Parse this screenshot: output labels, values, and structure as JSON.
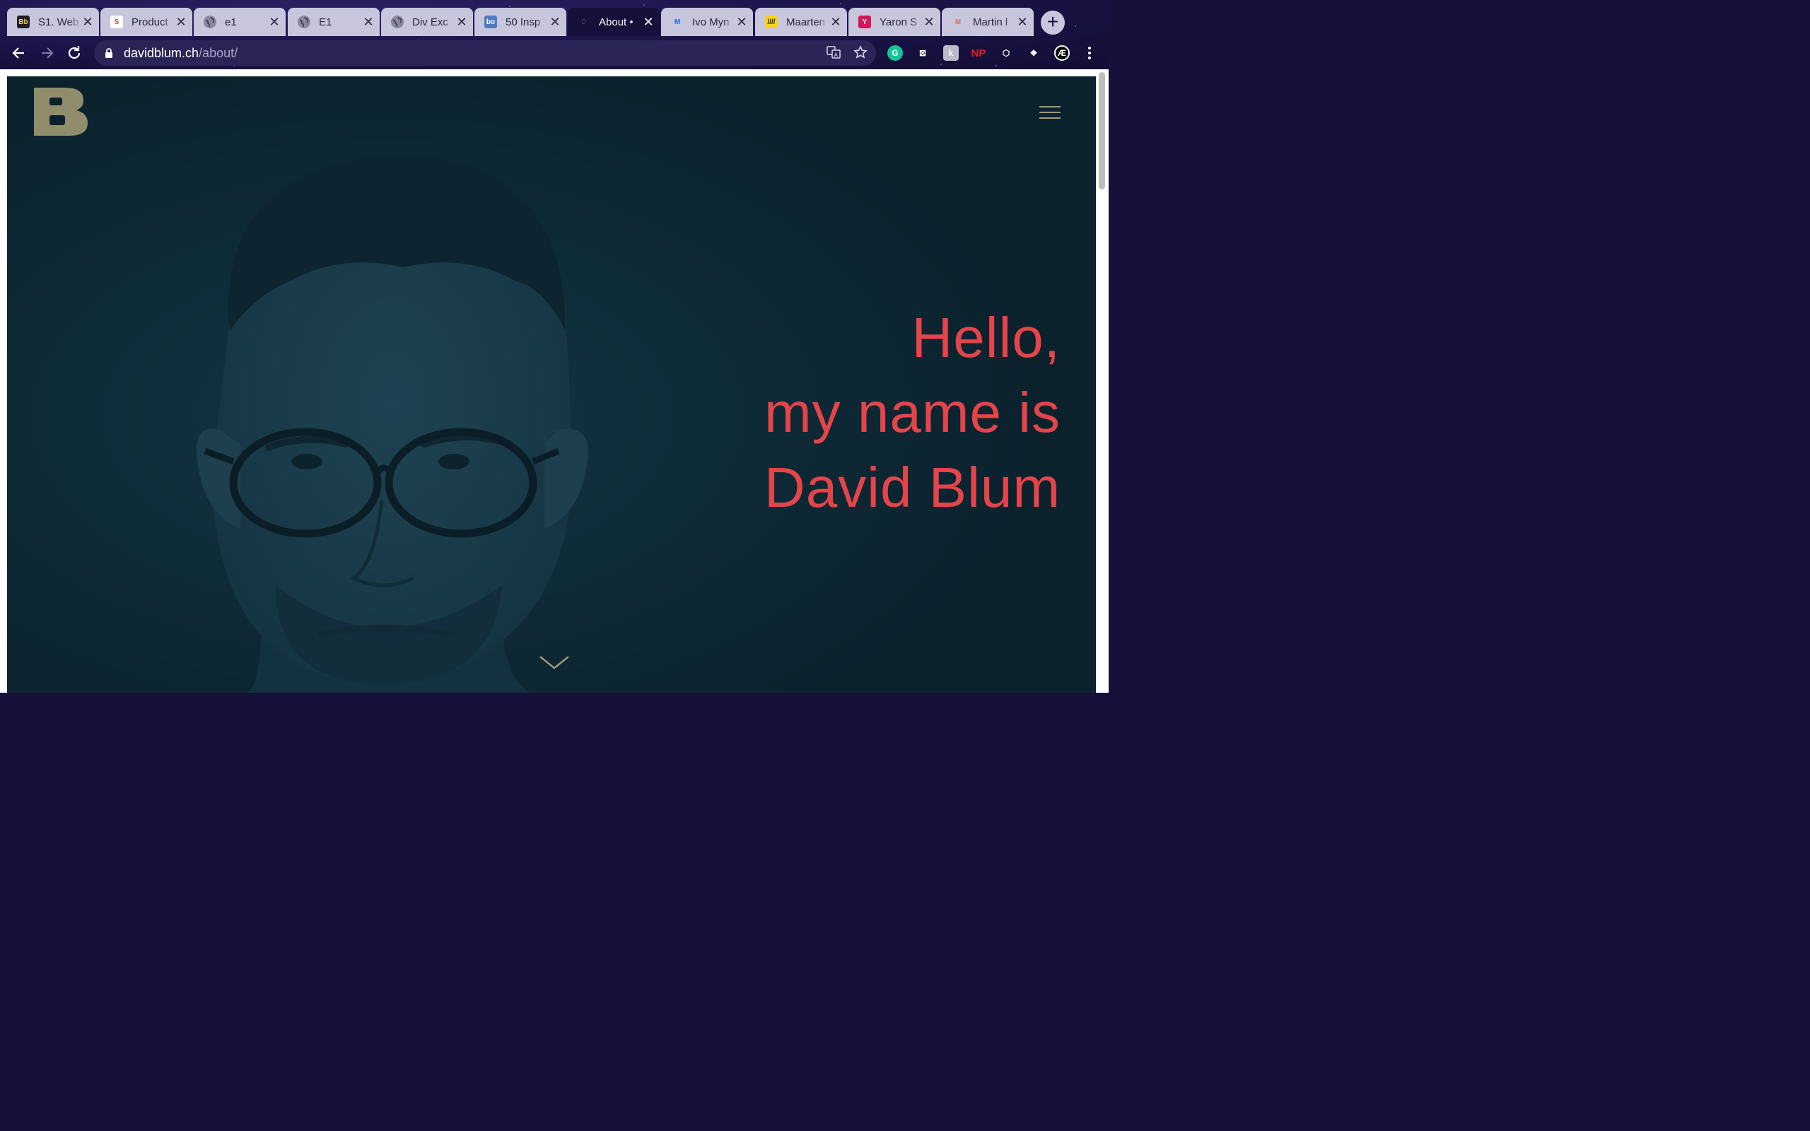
{
  "browser": {
    "tabs": [
      {
        "title": "S1. Web",
        "favicon": "Bb",
        "favicon_bg": "#1e1e1e",
        "favicon_fg": "#f0d060"
      },
      {
        "title": "Product",
        "favicon": "S",
        "favicon_bg": "#ffffff",
        "favicon_fg": "#e0413a"
      },
      {
        "title": "e1",
        "favicon": "globe-icon",
        "favicon_bg": "#8a879e",
        "favicon_fg": "#3b3850"
      },
      {
        "title": "E1",
        "favicon": "globe-icon",
        "favicon_bg": "#8a879e",
        "favicon_fg": "#3b3850"
      },
      {
        "title": "Div Exc",
        "favicon": "globe-icon",
        "favicon_bg": "#8a879e",
        "favicon_fg": "#3b3850"
      },
      {
        "title": "50 Insp",
        "favicon": "bo",
        "favicon_bg": "#4e7cc0",
        "favicon_fg": "#ffffff"
      },
      {
        "title": "About •",
        "favicon": "D",
        "favicon_bg": "#16103a",
        "favicon_fg": "#2b3a44",
        "active": true
      },
      {
        "title": "Ivo Myn",
        "favicon": "M",
        "favicon_bg": "#c8c6dd",
        "favicon_fg": "#1a6cf0"
      },
      {
        "title": "Maarten",
        "favicon": "////",
        "favicon_bg": "#f4d21c",
        "favicon_fg": "#1e1e1e"
      },
      {
        "title": "Yaron S",
        "favicon": "Y",
        "favicon_bg": "#d2175a",
        "favicon_fg": "#ffffff"
      },
      {
        "title": "Martin l",
        "favicon": "M",
        "favicon_bg": "#c8c6dd",
        "favicon_fg": "#e0704a"
      }
    ],
    "new_tab_label": "+",
    "url_host": "davidblum.ch",
    "url_path": "/about/",
    "extensions": [
      {
        "name": "grammarly-icon",
        "label": "G",
        "bg": "#15c39a",
        "fg": "#ffffff"
      },
      {
        "name": "extension-x-icon",
        "label": "⊠",
        "bg": "#16103a",
        "fg": "#ffffff"
      },
      {
        "name": "extension-k-icon",
        "label": "k",
        "bg": "#bdbbc9",
        "fg": "#ffffff"
      },
      {
        "name": "np-extension-icon",
        "label": "NP",
        "bg": "#16103a",
        "fg": "#e01c2c"
      },
      {
        "name": "shield-extension-icon",
        "label": "⬡",
        "bg": "#16103a",
        "fg": "#ffffff"
      },
      {
        "name": "puzzle-icon",
        "label": "❖",
        "bg": "#16103a",
        "fg": "#ffffff"
      },
      {
        "name": "profile-avatar-icon",
        "label": "Æ",
        "bg": "#000000",
        "fg": "#ffffff"
      }
    ]
  },
  "page": {
    "logo_letter": "B",
    "hero_lines": [
      "Hello,",
      "my name is",
      "David Blum"
    ],
    "colors": {
      "background": "#0b222d",
      "accent": "#e4444a",
      "logo": "#8f8d6c"
    }
  }
}
